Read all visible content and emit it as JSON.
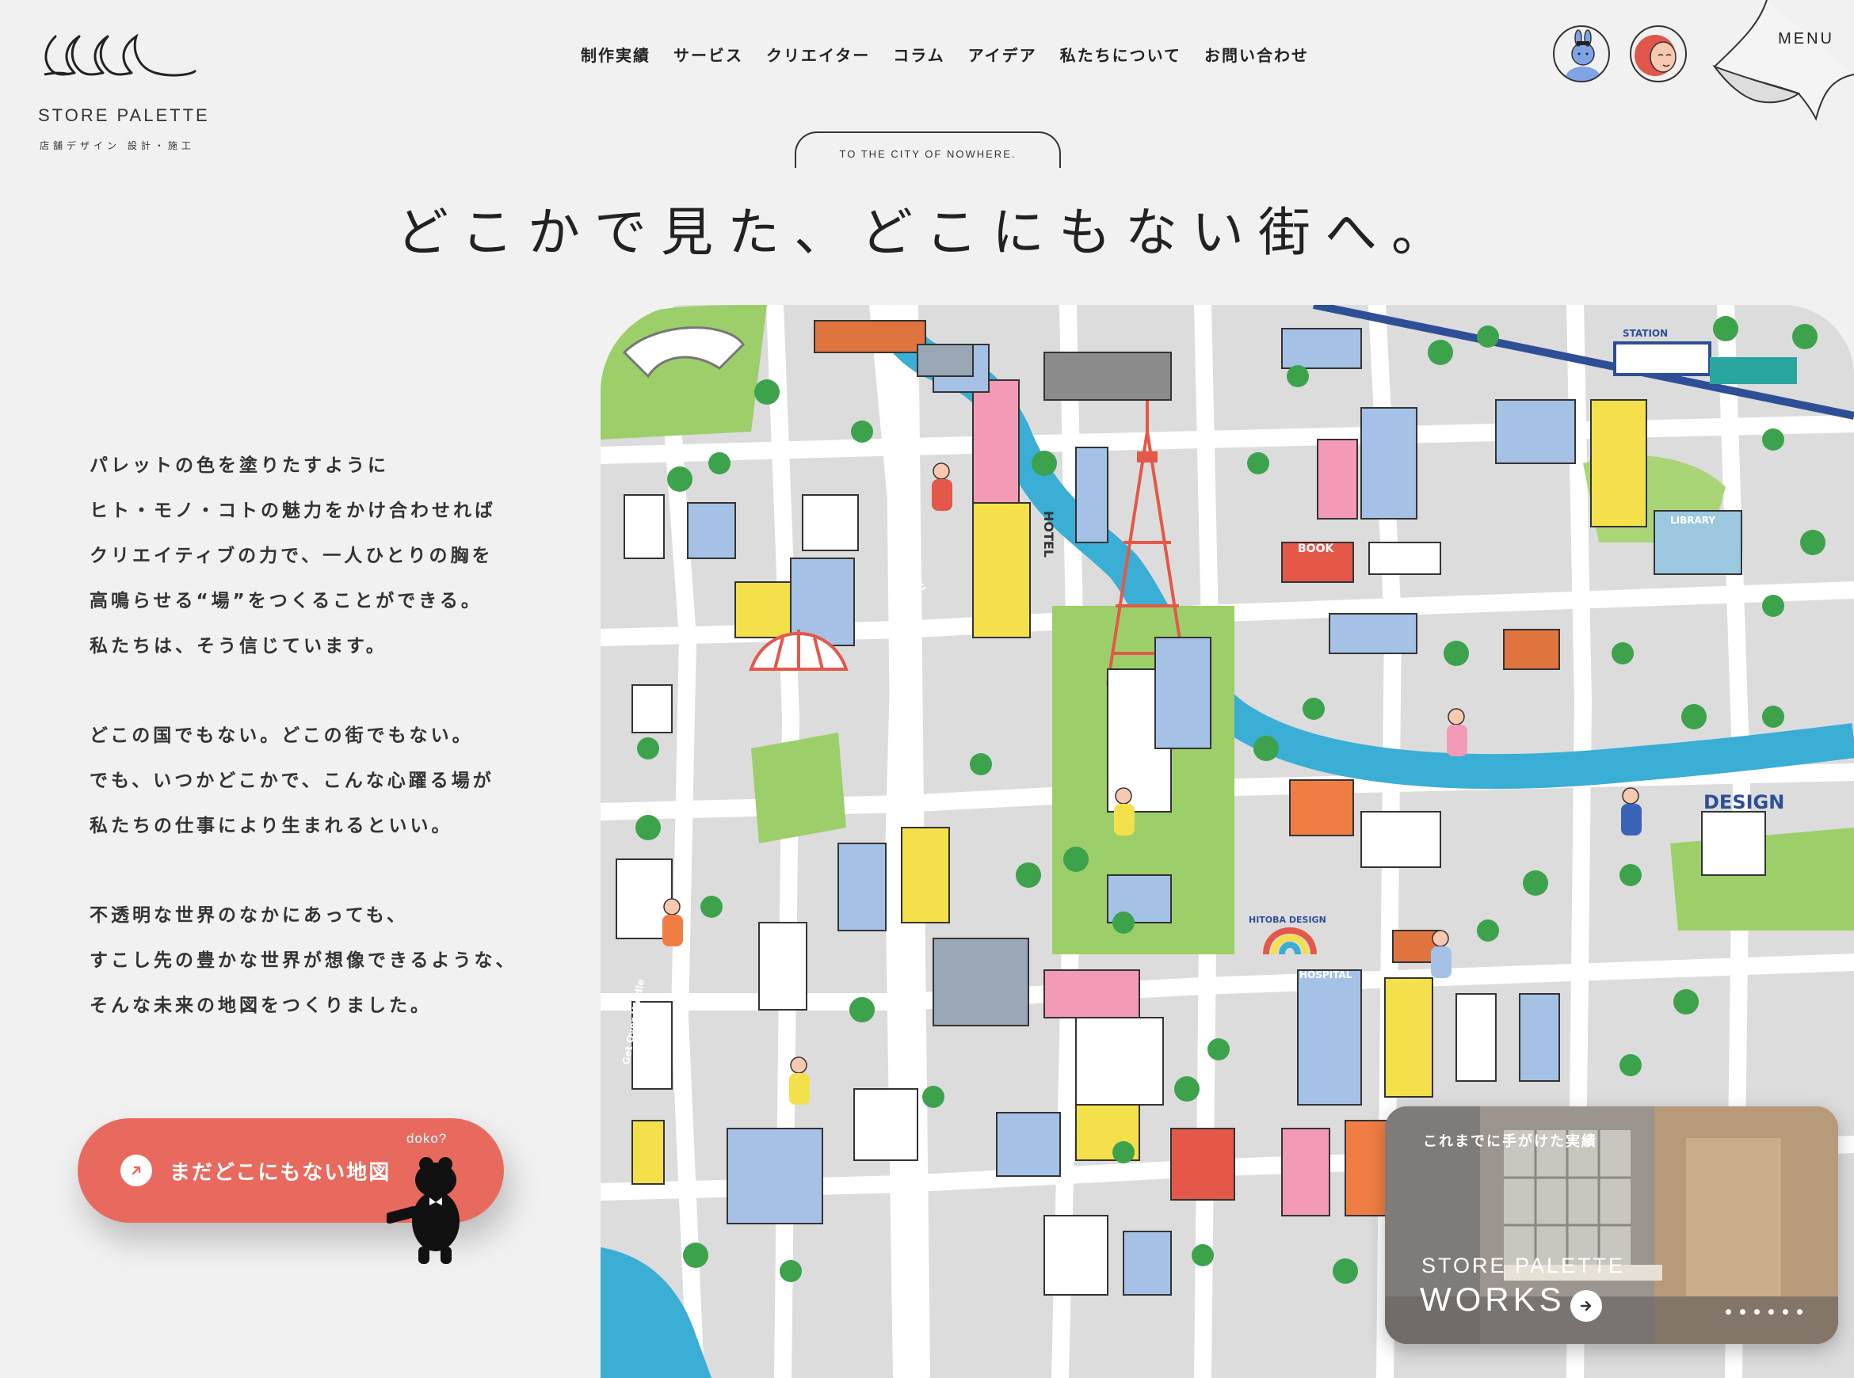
{
  "header": {
    "brand_name": "STORE PALETTE",
    "brand_sub": "店舗デザイン 設計・施工",
    "nav": [
      {
        "label": "制作実績"
      },
      {
        "label": "サービス"
      },
      {
        "label": "クリエイター"
      },
      {
        "label": "コラム"
      },
      {
        "label": "アイデア"
      },
      {
        "label": "私たちについて"
      },
      {
        "label": "お問い合わせ"
      }
    ],
    "menu_label": "MENU"
  },
  "hero": {
    "tagline": "TO THE CITY OF NOWHERE.",
    "title": "どこかで見た、どこにもない街へ。"
  },
  "copy": {
    "paragraphs": [
      [
        "パレットの色を塗りたすように",
        "ヒト・モノ・コトの魅力をかけ合わせれば",
        "クリエイティブの力で、一人ひとりの胸を",
        "高鳴らせる“場”をつくることができる。",
        "私たちは、そう信じています。"
      ],
      [
        "どこの国でもない。どこの街でもない。",
        "でも、いつかどこかで、こんな心躍る場が",
        "私たちの仕事により生まれるといい。"
      ],
      [
        "不透明な世界のなかにあっても、",
        "すこし先の豊かな世界が想像できるような、",
        "そんな未来の地図をつくりました。"
      ]
    ]
  },
  "cta": {
    "label": "まだどこにもない地図",
    "bubble": "doko?"
  },
  "map": {
    "labels": {
      "station": "STATION",
      "cafe": "CAFE",
      "hotel": "HOTEL",
      "book": "BOOK",
      "library": "LIBRARY",
      "design": "DESIGN",
      "hitoba": "HITOBA DESIGN",
      "hospital": "HOSPITAL",
      "skate": "Get Over Hurdle"
    }
  },
  "works": {
    "subtitle": "これまでに手がけた実績",
    "brand": "STORE PALETTE",
    "title": "WORKS"
  },
  "colors": {
    "accent": "#e86a5e",
    "river": "#3aaed4",
    "park": "#9ccf6a",
    "background": "#f1f1f1"
  }
}
